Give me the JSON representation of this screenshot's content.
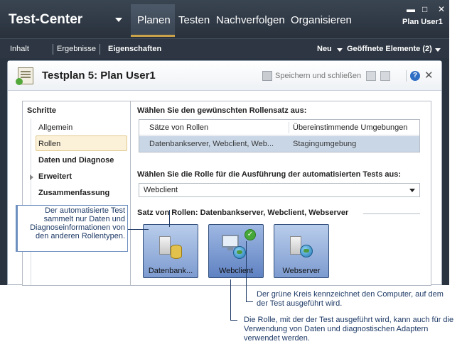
{
  "app": {
    "title": "Test-Center",
    "nav": [
      "Planen",
      "Testen",
      "Nachverfolgen",
      "Organisieren"
    ],
    "active_nav": "Planen",
    "user": "Plan User1"
  },
  "subbar": {
    "items": [
      "Inhalt",
      "Ergebnisse",
      "Eigenschaften"
    ],
    "new_label": "Neu",
    "open_items_label": "Geöffnete Elemente (2)"
  },
  "panel": {
    "title": "Testplan 5: Plan User1",
    "save_close_label": "Speichern und schließen"
  },
  "steps": {
    "header": "Schritte",
    "items": [
      "Allgemein",
      "Rollen",
      "Daten und Diagnose",
      "Erweitert",
      "Zusammenfassung"
    ],
    "selected": "Rollen"
  },
  "roles": {
    "set_label": "Wählen Sie den gewünschten Rollensatz aus:",
    "columns": [
      "Sätze von Rollen",
      "Übereinstimmende Umgebungen"
    ],
    "rows": [
      [
        "Datenbankserver, Webclient, Web...",
        "Stagingumgebung"
      ]
    ],
    "role_label": "Wählen Sie die Rolle für die Ausführung der automatisierten Tests aus:",
    "selected_role": "Webclient",
    "set_title": "Satz von Rollen: Datenbankserver, Webclient, Webserver",
    "cards": [
      "Datenbank...",
      "Webclient",
      "Webserver"
    ]
  },
  "annotations": {
    "left_callout": "Der automatisierte Test sammelt nur Daten und Diagnoseinformationen von den anderen Rollentypen.",
    "note_green": "Der grüne Kreis kennzeichnet den Computer, auf dem der Test ausgeführt wird.",
    "note_role": "Die Rolle, mit der der Test ausgeführt wird, kann auch für die Verwendung von Daten und diagnostischen Adaptern verwendet werden."
  },
  "icons": {
    "plan": "test-plan-icon",
    "save": "save-icon",
    "help": "help-icon",
    "close": "close-icon",
    "check": "green-check-icon"
  },
  "colors": {
    "chrome": "#2a3340",
    "selection": "#c9d6e6",
    "card": "#7d9bd0",
    "accent": "#47a83a",
    "callout": "#1e3a66"
  }
}
